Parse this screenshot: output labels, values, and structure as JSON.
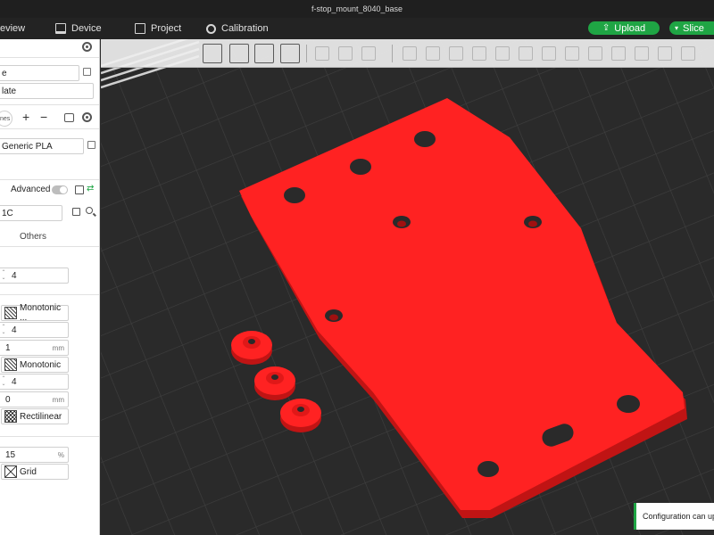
{
  "window": {
    "title": "f-stop_mount_8040_base"
  },
  "menu": {
    "preview": "eview",
    "device": "Device",
    "project": "Project",
    "calibration": "Calibration",
    "upload": "Upload",
    "slice": "Slice"
  },
  "panel": {
    "printer_name": "e",
    "plate": "late",
    "nozzle_chip": "nes",
    "filament": "Generic PLA",
    "advanced_label": "Advanced",
    "preset": "1C",
    "tab_others": "Others",
    "wall_loops": "4",
    "top_pattern": "Monotonic ...",
    "top_layers": "4",
    "top_thickness": "1",
    "top_thickness_unit": "mm",
    "bottom_pattern": "Monotonic",
    "bottom_layers": "4",
    "bottom_thickness": "0",
    "bottom_thickness_unit": "mm",
    "internal_pattern": "Rectilinear",
    "infill_density": "15",
    "infill_unit": "%",
    "infill_pattern": "Grid"
  },
  "toast": {
    "text": "Configuration can up"
  },
  "colors": {
    "accent": "#1fa544",
    "model": "#ff2222",
    "model_side": "#c41414",
    "plate": "#2c2c2c",
    "grid": "#3d3d3d"
  }
}
